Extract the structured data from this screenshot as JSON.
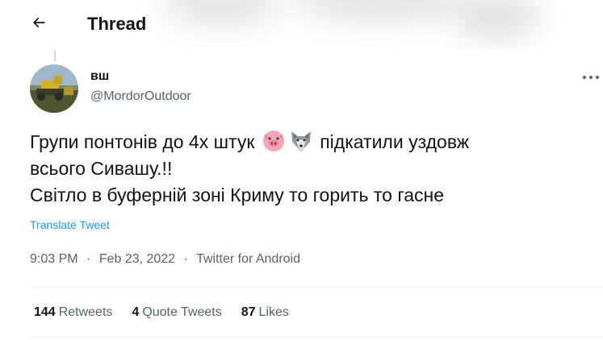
{
  "header": {
    "title": "Thread",
    "back_icon": "arrow-left-icon"
  },
  "tweet": {
    "author": {
      "name": "вш",
      "handle": "@MordorOutdoor"
    },
    "text_lines": [
      {
        "before": "Групи понтонів до 4х штук ",
        "after": " підкатили уздовж"
      },
      {
        "text": "всього Сивашу.!!"
      },
      {
        "text": "Світло в буферній зоні Криму то горить то гасне"
      }
    ],
    "emojis": [
      "pig-face-icon",
      "wolf-face-icon"
    ],
    "translate_label": "Translate Tweet",
    "time": "9:03 PM",
    "date": "Feb 23, 2022",
    "source": "Twitter for Android",
    "separator": "·",
    "stats": {
      "retweets_count": "144",
      "retweets_label": "Retweets",
      "quotes_count": "4",
      "quotes_label": "Quote Tweets",
      "likes_count": "87",
      "likes_label": "Likes"
    }
  },
  "colors": {
    "text": "#0f1419",
    "secondary": "#536471",
    "link": "#1d9bf0",
    "divider": "#eff3f4"
  }
}
